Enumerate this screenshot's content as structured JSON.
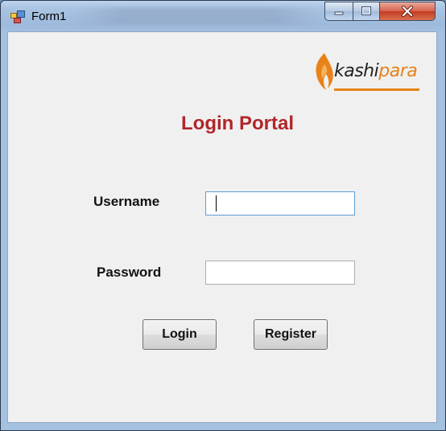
{
  "window": {
    "title": "Form1",
    "icons": {
      "app": "form-app-icon",
      "minimize": "minimize-icon",
      "maximize": "maximize-icon",
      "close": "close-icon"
    }
  },
  "logo": {
    "brand_part1": "kashi",
    "brand_part2": "para",
    "icon": "flame-logo-icon",
    "colors": {
      "accent": "#e8821a",
      "dark": "#222222"
    }
  },
  "form": {
    "title": "Login Portal",
    "title_color": "#b0262a",
    "username_label": "Username",
    "username_value": "",
    "password_label": "Password",
    "password_value": "",
    "login_label": "Login",
    "register_label": "Register"
  }
}
